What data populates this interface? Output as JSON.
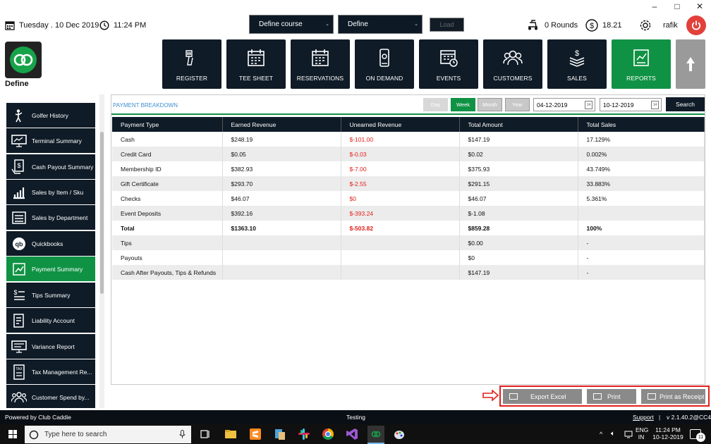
{
  "window": {
    "minimize": "–",
    "maximize": "□",
    "close": "✕"
  },
  "topbar": {
    "date": "Tuesday . 10 Dec 2019",
    "time": "11:24 PM",
    "course_select": "Define  course",
    "define_select": "Define",
    "load_label": "Load",
    "rounds": "0 Rounds",
    "balance": "18.21",
    "user": "rafik"
  },
  "logo_label": "Define",
  "nav": [
    {
      "label": "REGISTER",
      "icon": "barcode-scanner-icon"
    },
    {
      "label": "TEE SHEET",
      "icon": "calendar-icon"
    },
    {
      "label": "RESERVATIONS",
      "icon": "calendar-icon"
    },
    {
      "label": "ON DEMAND",
      "icon": "mobile-phone-icon"
    },
    {
      "label": "EVENTS",
      "icon": "events-calendar-icon"
    },
    {
      "label": "CUSTOMERS",
      "icon": "customers-icon"
    },
    {
      "label": "SALES",
      "icon": "money-stack-icon"
    },
    {
      "label": "REPORTS",
      "icon": "reports-icon"
    }
  ],
  "sidebar": [
    {
      "label": "Golfer History",
      "icon": "golfer-icon"
    },
    {
      "label": "Terminal Summary",
      "icon": "monitor-icon"
    },
    {
      "label": "Cash Payout Summary",
      "icon": "cash-payout-icon"
    },
    {
      "label": "Sales by Item / Sku",
      "icon": "bar-chart-icon"
    },
    {
      "label": "Sales by Department",
      "icon": "list-icon"
    },
    {
      "label": "Quickbooks",
      "icon": "quickbooks-icon"
    },
    {
      "label": "Payment Summary",
      "icon": "payment-icon"
    },
    {
      "label": "Tips Summary",
      "icon": "tips-icon"
    },
    {
      "label": "Liability Account",
      "icon": "document-icon"
    },
    {
      "label": "Variance Report",
      "icon": "monitor-icon"
    },
    {
      "label": "Tax Management Re...",
      "icon": "tax-icon"
    },
    {
      "label": "Customer Spend by...",
      "icon": "customers-icon"
    }
  ],
  "panel": {
    "title": "PAYMENT BREAKDOWN",
    "periods": [
      "Day",
      "Week",
      "Month",
      "Year"
    ],
    "selected_period": "Week",
    "start_date": "04-12-2019",
    "end_date": "10-12-2019",
    "calendar_label": "14",
    "search_label": "Search"
  },
  "table": {
    "headers": [
      "Payment Type",
      "Earned Revenue",
      "Unearned Revenue",
      "Total Amount",
      "Total Sales"
    ],
    "rows": [
      [
        "Cash",
        "$248.19",
        "$-101.00",
        "$147.19",
        "17.129%"
      ],
      [
        "Credit Card",
        "$0.05",
        "$-0.03",
        "$0.02",
        "0.002%"
      ],
      [
        "Membership ID",
        "$382.93",
        "$-7.00",
        "$375.93",
        "43.749%"
      ],
      [
        "Gift Certificate",
        "$293.70",
        "$-2.55",
        "$291.15",
        "33.883%"
      ],
      [
        "Checks",
        "$46.07",
        "$0",
        "$46.07",
        "5.361%"
      ],
      [
        "Event Deposits",
        "$392.16",
        "$-393.24",
        "$-1.08",
        ""
      ],
      [
        "Total",
        "$1363.10",
        "$-503.82",
        "$859.28",
        "100%"
      ],
      [
        "Tips",
        "",
        "",
        "$0.00",
        "-"
      ],
      [
        "Payouts",
        "",
        "",
        "$0",
        "-"
      ],
      [
        "Cash After Payouts, Tips & Refunds",
        "",
        "",
        "$147.19",
        "-"
      ]
    ]
  },
  "actions": {
    "export": "Export Excel",
    "print": "Print",
    "receipt": "Print as Receipt"
  },
  "footer": {
    "powered": "Powered by Club Caddie",
    "env": "Testing",
    "support": "Support",
    "version": "v 2.1.40.2@CC4"
  },
  "taskbar": {
    "search_placeholder": "Type here to search",
    "lang1": "ENG",
    "lang2": "IN",
    "time": "11:24 PM",
    "date": "10-12-2019",
    "notif_count": "11"
  },
  "colors": {
    "navy": "#0f1b27",
    "green": "#109244",
    "negative": "#e0201a",
    "link": "#3f8fd0"
  }
}
